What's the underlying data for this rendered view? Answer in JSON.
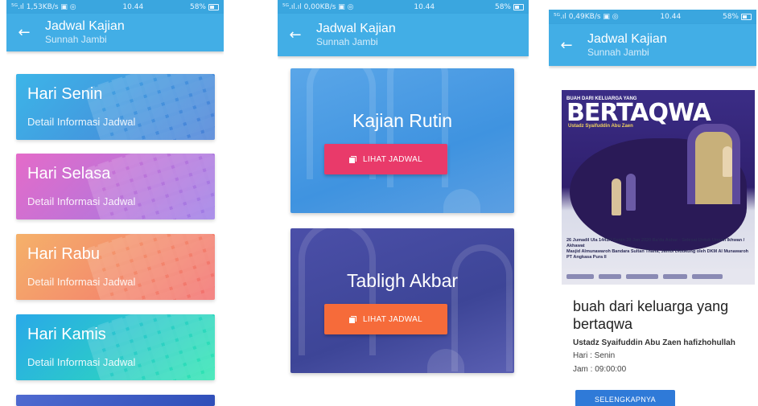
{
  "screens": [
    {
      "status": {
        "left": "⁵ᴳ.ıl 1,53KB/s ▣ ◎",
        "time": "10.44",
        "battery": "58%"
      },
      "appbar": {
        "title": "Jadwal Kajian",
        "subtitle": "Sunnah Jambi"
      },
      "days": [
        {
          "name": "Hari Senin",
          "detail": "Detail Informasi Jadwal"
        },
        {
          "name": "Hari Selasa",
          "detail": "Detail Informasi Jadwal"
        },
        {
          "name": "Hari Rabu",
          "detail": "Detail Informasi Jadwal"
        },
        {
          "name": "Hari Kamis",
          "detail": "Detail Informasi Jadwal"
        }
      ]
    },
    {
      "status": {
        "left": "⁵ᴳ.ıl.ıl 0,00KB/s ▣ ◎",
        "time": "10.44",
        "battery": "58%"
      },
      "appbar": {
        "title": "Jadwal Kajian",
        "subtitle": "Sunnah Jambi"
      },
      "events": [
        {
          "title": "Kajian Rutin",
          "button": "LIHAT JADWAL"
        },
        {
          "title": "Tabligh Akbar",
          "button": "LIHAT JADWAL"
        }
      ]
    },
    {
      "status": {
        "left": "⁵ᴳ.ıl 0,49KB/s ▣ ◎",
        "time": "10.44",
        "battery": "58%"
      },
      "appbar": {
        "title": "Jadwal Kajian",
        "subtitle": "Sunnah Jambi"
      },
      "poster": {
        "line1": "BUAH DARI KELUARGA YANG",
        "line2": "BERTAQWA",
        "line3": "Ustadz Syaifuddin Abu Zaen",
        "date_block": "26 Jumadil Ula 1441H  Senin 20 Jan 2020  Ba'da Ashar - Selesai  Untuk Umum Ikhwan / Akhawat",
        "venue_block": "Masjid Almunawaroh  Bandara Sultan Thaha, Jambi  Didukung oleh DKM Al Munawaroh PT Angkasa Pura II"
      },
      "detail": {
        "title": "buah dari keluarga yang bertaqwa",
        "speaker": "Ustadz Syaifuddin Abu Zaen hafizhohullah",
        "day": "Hari : Senin",
        "time": "Jam : 09:00:00",
        "button": "SELENGKAPNYA"
      }
    }
  ],
  "colors": {
    "appbar": "#42aee6",
    "status": "#3aa6df",
    "btn_pink": "#e93a6a",
    "btn_orange": "#f66b3a",
    "btn_blue": "#2f7ad8"
  }
}
